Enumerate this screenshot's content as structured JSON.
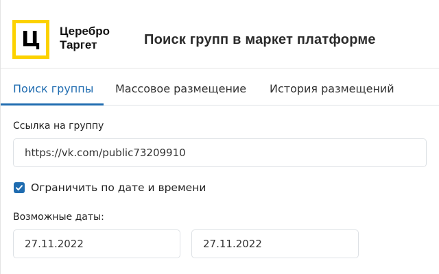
{
  "brand": {
    "logo_letter": "Ц",
    "name_line1": "Церебро",
    "name_line2": "Таргет",
    "logo_color": "#fcd200"
  },
  "header": {
    "title": "Поиск групп в маркет платформе"
  },
  "tabs": [
    {
      "label": "Поиск группы",
      "active": true
    },
    {
      "label": "Массовое размещение",
      "active": false
    },
    {
      "label": "История размещений",
      "active": false
    }
  ],
  "form": {
    "group_link_label": "Ссылка на группу",
    "group_link_value": "https://vk.com/public73209910",
    "limit_checkbox_label": "Ограничить по дате и времени",
    "limit_checkbox_checked": true,
    "dates_label": "Возможные даты:",
    "date_from": "27.11.2022",
    "date_to": "27.11.2022"
  },
  "colors": {
    "accent": "#1f6cb0",
    "border": "#dde1e5"
  }
}
